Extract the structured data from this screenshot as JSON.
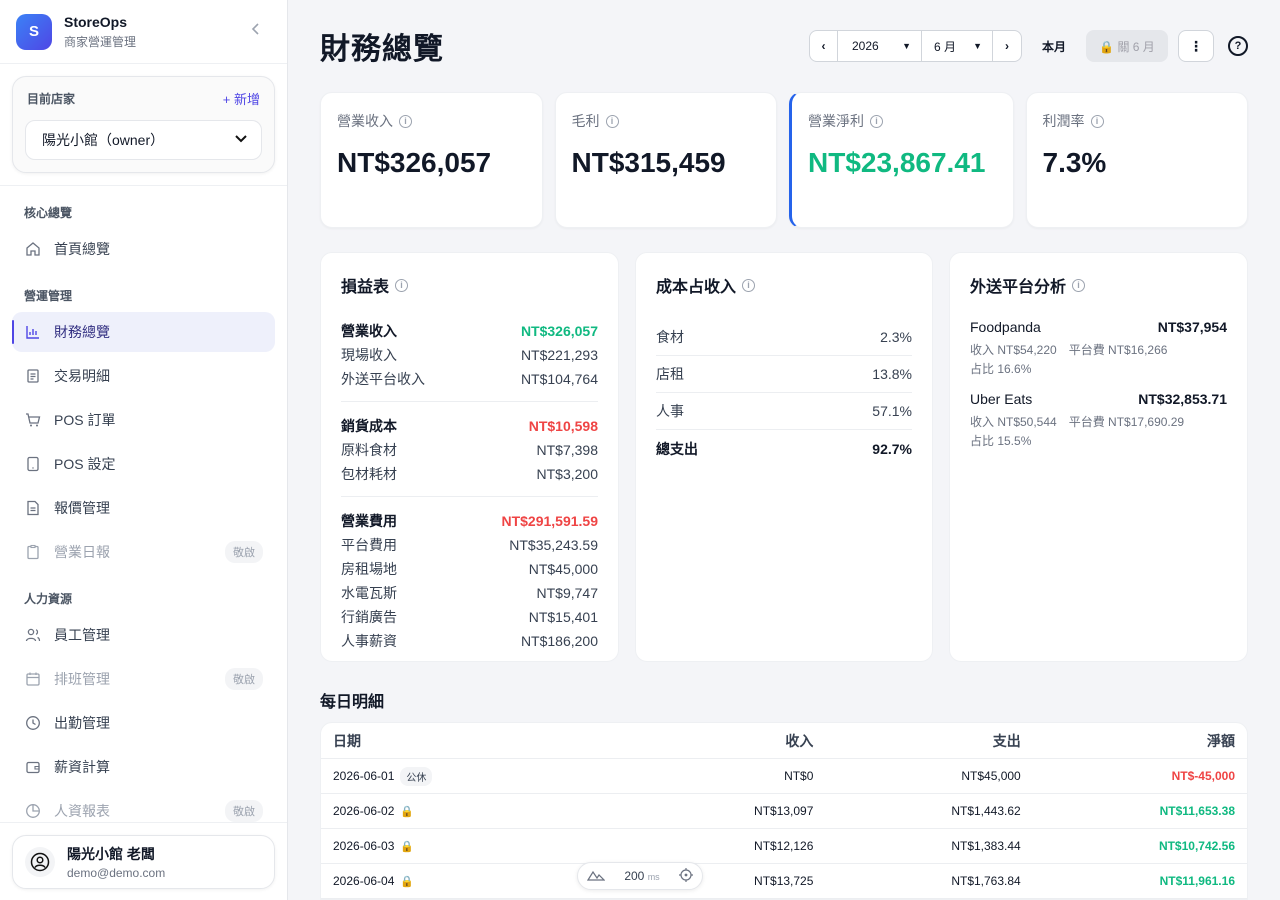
{
  "brand": {
    "logo_letter": "S",
    "name": "StoreOps",
    "subtitle": "商家營運管理"
  },
  "store": {
    "label": "目前店家",
    "add_label": "+ 新增",
    "selected": "陽光小館（owner）"
  },
  "nav": {
    "sections": [
      {
        "title": "核心總覽"
      },
      {
        "title": "營運管理"
      },
      {
        "title": "人力資源"
      }
    ],
    "items": [
      {
        "label": "首頁總覽"
      },
      {
        "label": "財務總覽"
      },
      {
        "label": "交易明細"
      },
      {
        "label": "POS 訂單"
      },
      {
        "label": "POS 設定"
      },
      {
        "label": "報價管理"
      },
      {
        "label": "營業日報",
        "badge": "敬啟"
      },
      {
        "label": "員工管理"
      },
      {
        "label": "排班管理",
        "badge": "敬啟"
      },
      {
        "label": "出勤管理"
      },
      {
        "label": "薪資計算"
      },
      {
        "label": "人資報表",
        "badge": "敬啟"
      }
    ]
  },
  "user": {
    "name": "陽光小館 老闆",
    "email": "demo@demo.com"
  },
  "header": {
    "title": "財務總覽",
    "year": "2026",
    "month": "6 月",
    "this_month": "本月",
    "close_label": "🔒 關 6 月"
  },
  "kpis": [
    {
      "label": "營業收入",
      "value": "NT$326,057"
    },
    {
      "label": "毛利",
      "value": "NT$315,459"
    },
    {
      "label": "營業淨利",
      "value": "NT$23,867.41"
    },
    {
      "label": "利潤率",
      "value": "7.3%"
    }
  ],
  "pl": {
    "title": "損益表",
    "groups": [
      {
        "head": "營業收入",
        "head_value": "NT$326,057",
        "rows": [
          [
            "現場收入",
            "NT$221,293"
          ],
          [
            "外送平台收入",
            "NT$104,764"
          ]
        ]
      },
      {
        "head": "銷貨成本",
        "head_value": "NT$10,598",
        "rows": [
          [
            "原料食材",
            "NT$7,398"
          ],
          [
            "包材耗材",
            "NT$3,200"
          ]
        ]
      },
      {
        "head": "營業費用",
        "head_value": "NT$291,591.59",
        "rows": [
          [
            "平台費用",
            "NT$35,243.59"
          ],
          [
            "房租場地",
            "NT$45,000"
          ],
          [
            "水電瓦斯",
            "NT$9,747"
          ],
          [
            "行銷廣告",
            "NT$15,401"
          ],
          [
            "人事薪資",
            "NT$186,200"
          ]
        ]
      }
    ]
  },
  "cost": {
    "title": "成本占收入",
    "rows": [
      [
        "食材",
        "2.3%"
      ],
      [
        "店租",
        "13.8%"
      ],
      [
        "人事",
        "57.1%"
      ],
      [
        "總支出",
        "92.7%"
      ]
    ]
  },
  "delivery": {
    "title": "外送平台分析",
    "platforms": [
      {
        "name": "Foodpanda",
        "net": "NT$37,954",
        "revenue": "收入 NT$54,220",
        "fee": "平台費 NT$16,266",
        "share": "占比 16.6%"
      },
      {
        "name": "Uber Eats",
        "net": "NT$32,853.71",
        "revenue": "收入 NT$50,544",
        "fee": "平台費 NT$17,690.29",
        "share": "占比 15.5%"
      }
    ]
  },
  "daily": {
    "title": "每日明細",
    "columns": [
      "日期",
      "收入",
      "支出",
      "淨額"
    ],
    "rows": [
      {
        "date": "2026-06-01",
        "tag": "公休",
        "in": "NT$0",
        "out": "NT$45,000",
        "net": "NT$-45,000"
      },
      {
        "date": "2026-06-02",
        "in": "NT$13,097",
        "out": "NT$1,443.62",
        "net": "NT$11,653.38"
      },
      {
        "date": "2026-06-03",
        "in": "NT$12,126",
        "out": "NT$1,383.44",
        "net": "NT$10,742.56"
      },
      {
        "date": "2026-06-04",
        "in": "NT$13,725",
        "out": "NT$1,763.84",
        "net": "NT$11,961.16"
      }
    ]
  },
  "floatbar": {
    "value": "200",
    "unit": "ms"
  },
  "colors": {
    "accent": "#4f46e5",
    "positive": "#10b981",
    "negative": "#ef4444"
  }
}
